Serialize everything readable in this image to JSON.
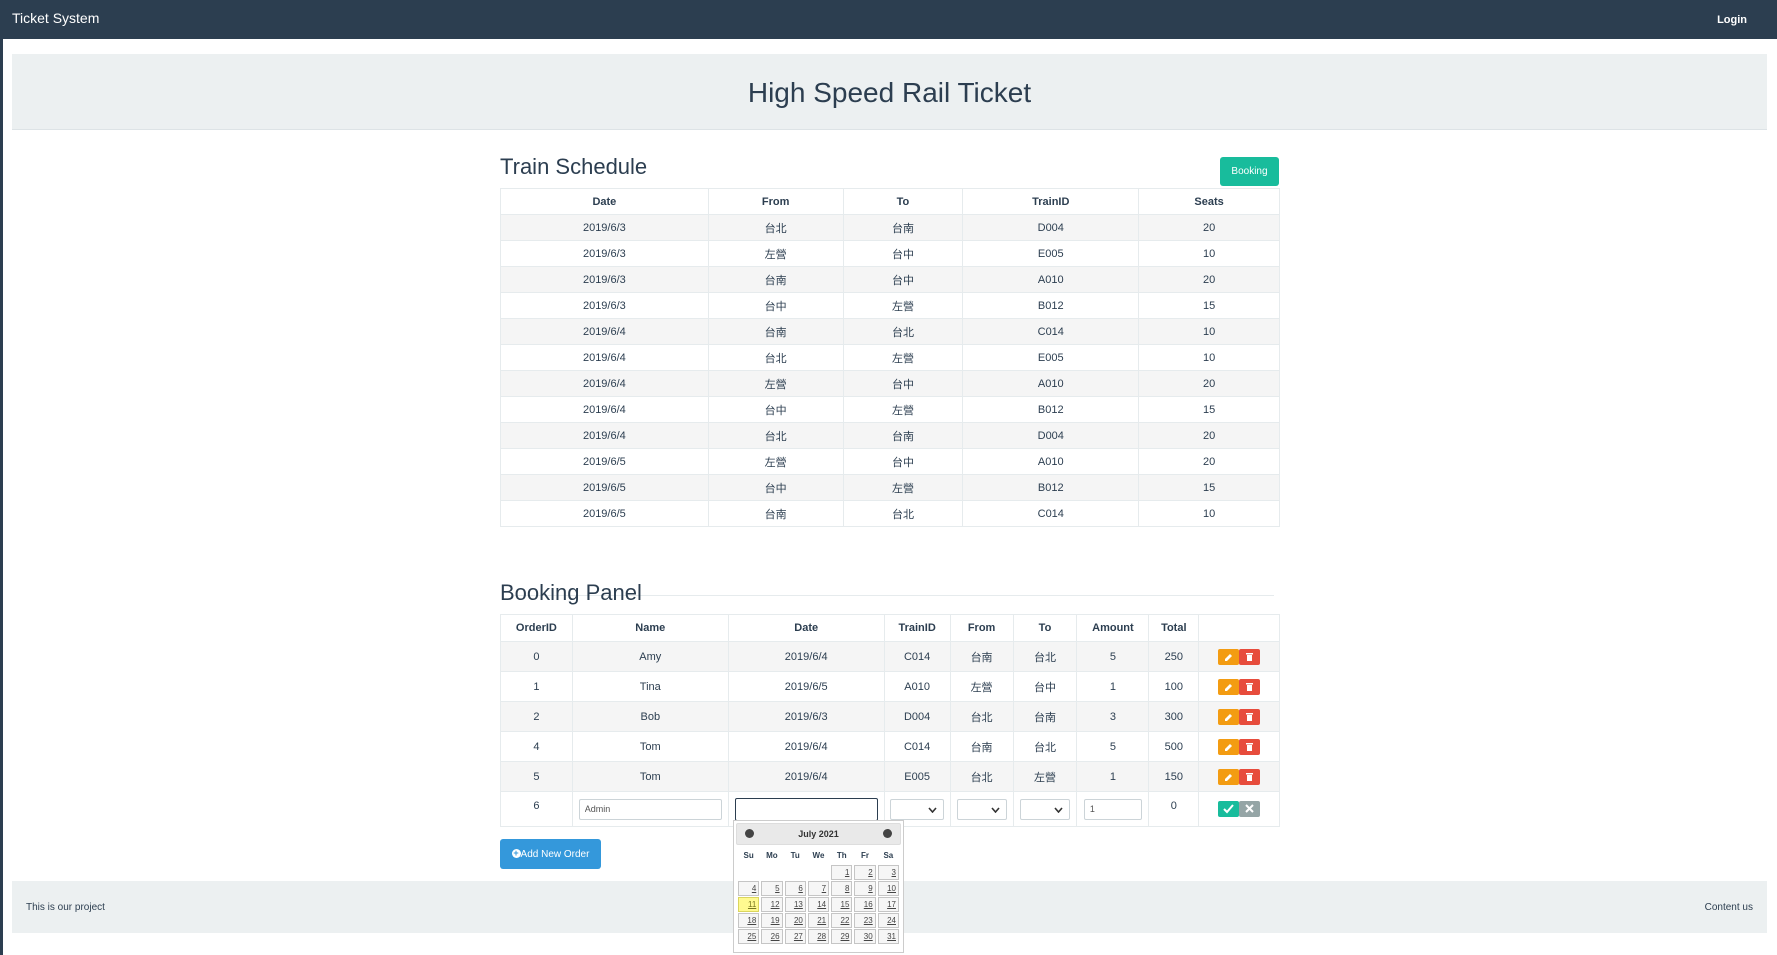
{
  "navbar": {
    "brand": "Ticket System",
    "login": "Login"
  },
  "header": {
    "title": "High Speed Rail Ticket"
  },
  "schedule": {
    "title": "Train Schedule",
    "booking_button": "Booking",
    "columns": [
      "Date",
      "From",
      "To",
      "TrainID",
      "Seats"
    ],
    "rows": [
      [
        "2019/6/3",
        "台北",
        "台南",
        "D004",
        "20"
      ],
      [
        "2019/6/3",
        "左營",
        "台中",
        "E005",
        "10"
      ],
      [
        "2019/6/3",
        "台南",
        "台中",
        "A010",
        "20"
      ],
      [
        "2019/6/3",
        "台中",
        "左營",
        "B012",
        "15"
      ],
      [
        "2019/6/4",
        "台南",
        "台北",
        "C014",
        "10"
      ],
      [
        "2019/6/4",
        "台北",
        "左營",
        "E005",
        "10"
      ],
      [
        "2019/6/4",
        "左營",
        "台中",
        "A010",
        "20"
      ],
      [
        "2019/6/4",
        "台中",
        "左營",
        "B012",
        "15"
      ],
      [
        "2019/6/4",
        "台北",
        "台南",
        "D004",
        "20"
      ],
      [
        "2019/6/5",
        "左營",
        "台中",
        "A010",
        "20"
      ],
      [
        "2019/6/5",
        "台中",
        "左營",
        "B012",
        "15"
      ],
      [
        "2019/6/5",
        "台南",
        "台北",
        "C014",
        "10"
      ]
    ]
  },
  "booking": {
    "title": "Booking Panel",
    "columns": [
      "OrderID",
      "Name",
      "Date",
      "TrainID",
      "From",
      "To",
      "Amount",
      "Total",
      ""
    ],
    "rows": [
      [
        "0",
        "Amy",
        "2019/6/4",
        "C014",
        "台南",
        "台北",
        "5",
        "250"
      ],
      [
        "1",
        "Tina",
        "2019/6/5",
        "A010",
        "左營",
        "台中",
        "1",
        "100"
      ],
      [
        "2",
        "Bob",
        "2019/6/3",
        "D004",
        "台北",
        "台南",
        "3",
        "300"
      ],
      [
        "4",
        "Tom",
        "2019/6/4",
        "C014",
        "台南",
        "台北",
        "5",
        "500"
      ],
      [
        "5",
        "Tom",
        "2019/6/4",
        "E005",
        "台北",
        "左營",
        "1",
        "150"
      ]
    ],
    "new_row": {
      "order_id": "6",
      "name_value": "Admin",
      "date_value": "",
      "amount_value": "1",
      "total": "0"
    },
    "add_button": "Add New Order"
  },
  "datepicker": {
    "title": "July 2021",
    "weekdays": [
      "Su",
      "Mo",
      "Tu",
      "We",
      "Th",
      "Fr",
      "Sa"
    ],
    "weeks": [
      [
        "",
        "",
        "",
        "",
        "1",
        "2",
        "3"
      ],
      [
        "4",
        "5",
        "6",
        "7",
        "8",
        "9",
        "10"
      ],
      [
        "11",
        "12",
        "13",
        "14",
        "15",
        "16",
        "17"
      ],
      [
        "18",
        "19",
        "20",
        "21",
        "22",
        "23",
        "24"
      ],
      [
        "25",
        "26",
        "27",
        "28",
        "29",
        "30",
        "31"
      ]
    ],
    "today": "11"
  },
  "footer": {
    "left": "This is our project",
    "right": "Content us"
  },
  "colors": {
    "navbar": "#2c3e50",
    "teal": "#18bc9c",
    "blue": "#3498db",
    "orange": "#f39c12",
    "red": "#e74c3c"
  }
}
